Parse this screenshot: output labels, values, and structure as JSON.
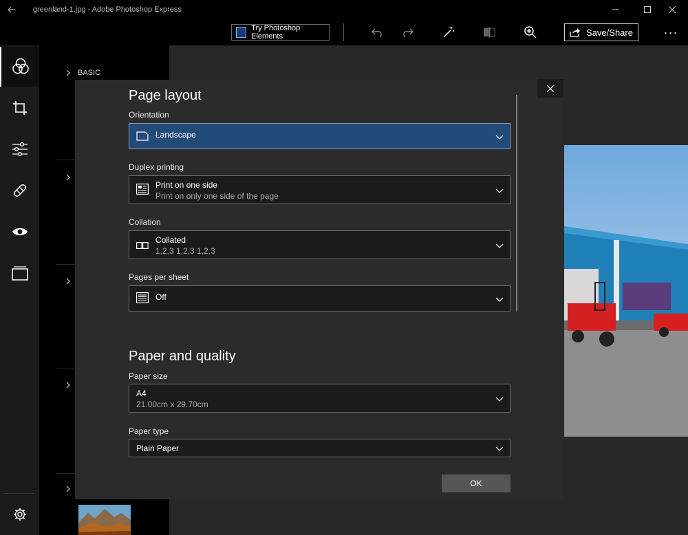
{
  "window": {
    "title": "greenland-1.jpg - Adobe Photoshop Express",
    "back_icon": "back-arrow-icon",
    "controls": [
      "minimize-icon",
      "maximize-icon",
      "close-icon"
    ]
  },
  "toolbar": {
    "try_label": "Try Photoshop Elements",
    "save_label": "Save/Share",
    "more_label": "···",
    "icons": [
      "undo-icon",
      "redo-icon",
      "auto-fix-icon",
      "compare-icon",
      "zoom-in-icon",
      "share-icon"
    ]
  },
  "sidebar": {
    "items": [
      {
        "icon": "looks-icon",
        "active": true
      },
      {
        "icon": "crop-icon"
      },
      {
        "icon": "adjustments-icon"
      },
      {
        "icon": "healing-icon"
      },
      {
        "icon": "eye-icon"
      },
      {
        "icon": "borders-icon"
      }
    ],
    "settings_icon": "gear-icon"
  },
  "panel": {
    "first_label": "BASIC"
  },
  "dialog": {
    "section1_title": "Page layout",
    "orientation": {
      "label": "Orientation",
      "value": "Landscape"
    },
    "duplex": {
      "label": "Duplex printing",
      "value": "Print on one side",
      "detail": "Print on only one side of the page"
    },
    "collation": {
      "label": "Collation",
      "value": "Collated",
      "detail": "1,2,3 1,2,3 1,2,3"
    },
    "pages_per_sheet": {
      "label": "Pages per sheet",
      "value": "Off"
    },
    "section2_title": "Paper and quality",
    "paper_size": {
      "label": "Paper size",
      "value": "A4",
      "detail": "21.00cm x 29.70cm"
    },
    "paper_type": {
      "label": "Paper type",
      "value": "Plain Paper"
    },
    "ok_label": "OK",
    "close_icon": "close-icon"
  },
  "colors": {
    "accent": "#234b79",
    "dialog_bg": "#2b2b2b",
    "workspace_bg": "#282828"
  }
}
